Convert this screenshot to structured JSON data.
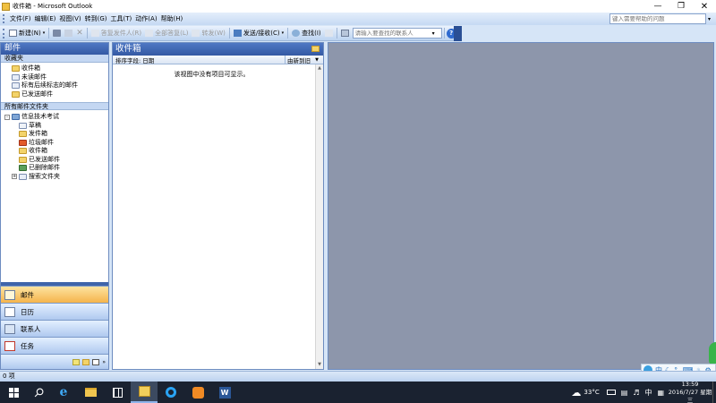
{
  "window": {
    "title": "收件箱 - Microsoft Outlook"
  },
  "menu": {
    "items": [
      "文件(F)",
      "编辑(E)",
      "视图(V)",
      "转到(G)",
      "工具(T)",
      "动作(A)",
      "帮助(H)"
    ],
    "help_placeholder": "键入需要帮助的问题"
  },
  "toolbar": {
    "new": "新建(N)",
    "reply_sender": "答复发件人(R)",
    "reply_all": "全部答复(L)",
    "forward": "转发(W)",
    "send_receive": "发送/接收(C)",
    "find": "查找(I)",
    "contact_search_placeholder": "请输入要查找的联系人"
  },
  "nav": {
    "header": "邮件",
    "favorites_header": "收藏夹",
    "favorites": [
      "收件箱",
      "未读邮件",
      "标有后续标志的邮件",
      "已发送邮件"
    ],
    "all_folders_header": "所有邮件文件夹",
    "root": "信息技术考试",
    "folders": [
      "草稿",
      "发件箱",
      "垃圾邮件",
      "收件箱",
      "已发送邮件",
      "已删除邮件",
      "搜索文件夹"
    ],
    "buttons": [
      "邮件",
      "日历",
      "联系人",
      "任务"
    ]
  },
  "inbox": {
    "title": "收件箱",
    "sort_label": "排序字段: 日期",
    "order_label": "由新到旧",
    "empty_message": "该视图中没有项目可显示。"
  },
  "status": {
    "count": "0 项"
  },
  "taskbar": {
    "temperature": "33°C",
    "ime": "中",
    "time": "13:59",
    "date": "2016/7/27 星期三"
  },
  "colors": {
    "reading_pane": "#8d96ab",
    "header_blue": "#3a63b0",
    "active_nav": "#f8c46a",
    "taskbar": "#1a2230"
  }
}
